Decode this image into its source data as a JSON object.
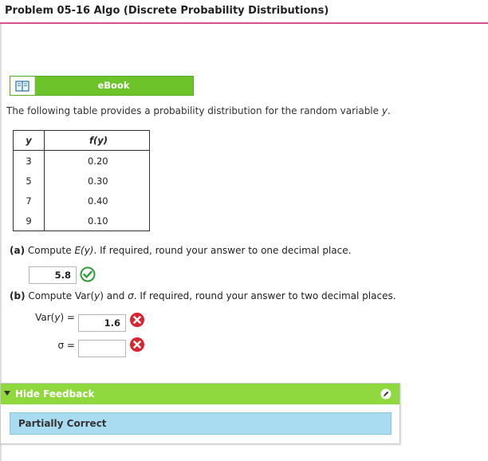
{
  "header": {
    "title": "Problem 05-16 Algo (Discrete Probability Distributions)"
  },
  "ebook": {
    "label": "eBook",
    "icon": "book-icon"
  },
  "intro": {
    "text_before": "The following table provides a probability distribution for the random variable ",
    "variable": "y",
    "text_after": "."
  },
  "table": {
    "headers": [
      "y",
      "f(y)"
    ],
    "rows": [
      [
        "3",
        "0.20"
      ],
      [
        "5",
        "0.30"
      ],
      [
        "7",
        "0.40"
      ],
      [
        "9",
        "0.10"
      ]
    ]
  },
  "part_a": {
    "tag": "(a)",
    "text_before": " Compute ",
    "expr": "E(y)",
    "text_after": ". If required, round your answer to one decimal place.",
    "answer": "5.8",
    "status": "correct"
  },
  "part_b": {
    "tag": "(b)",
    "text_before": " Compute Var(",
    "var": "y",
    "text_mid": ") and ",
    "sigma": "σ",
    "text_after": ". If required, round your answer to two decimal places.",
    "var_label_pre": "Var(",
    "var_label_var": "y",
    "var_label_post": ") =",
    "var_answer": "1.6",
    "var_status": "incorrect",
    "sigma_label": "σ =",
    "sigma_answer": "",
    "sigma_status": "incorrect"
  },
  "feedback": {
    "toggle_label": "Hide Feedback",
    "result": "Partially Correct"
  },
  "colors": {
    "accent_pink": "#d94f9a",
    "ebook_green": "#6cc42a",
    "feedback_green": "#8fd83e",
    "result_blue": "#a9dcf0",
    "correct": "#2e9e3a",
    "incorrect": "#d9232e"
  }
}
